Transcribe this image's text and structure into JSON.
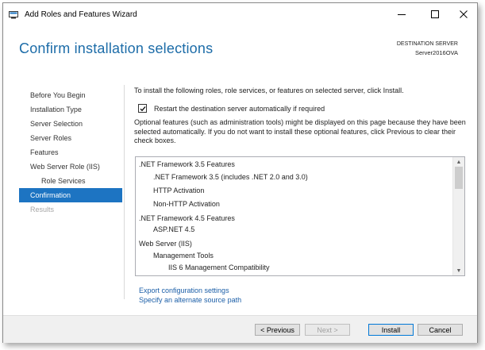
{
  "window": {
    "title": "Add Roles and Features Wizard",
    "controls": {
      "minimize": "—",
      "maximize": "☐",
      "close": "✕"
    }
  },
  "header": {
    "page_title": "Confirm installation selections",
    "destination_label": "DESTINATION SERVER",
    "destination_server": "Server2016OVA"
  },
  "nav": {
    "items": [
      {
        "label": "Before You Begin",
        "state": "normal"
      },
      {
        "label": "Installation Type",
        "state": "normal"
      },
      {
        "label": "Server Selection",
        "state": "normal"
      },
      {
        "label": "Server Roles",
        "state": "normal"
      },
      {
        "label": "Features",
        "state": "normal"
      },
      {
        "label": "Web Server Role (IIS)",
        "state": "normal"
      },
      {
        "label": "Role Services",
        "state": "normal"
      },
      {
        "label": "Confirmation",
        "state": "active"
      },
      {
        "label": "Results",
        "state": "disabled"
      }
    ]
  },
  "content": {
    "intro": "To install the following roles, role services, or features on selected server, click Install.",
    "restart_checked": true,
    "restart_label": "Restart the destination server automatically if required",
    "optional_text": "Optional features (such as administration tools) might be displayed on this page because they have been selected automatically. If you do not want to install these optional features, click Previous to clear their check boxes.",
    "features": [
      {
        "label": ".NET Framework 3.5 Features",
        "level": 0
      },
      {
        "label": ".NET Framework 3.5 (includes .NET 2.0 and 3.0)",
        "level": 1
      },
      {
        "label": "HTTP Activation",
        "level": 1
      },
      {
        "label": "Non-HTTP Activation",
        "level": 1
      },
      {
        "label": ".NET Framework 4.5 Features",
        "level": 0
      },
      {
        "label": "ASP.NET 4.5",
        "level": 1
      },
      {
        "label": "Web Server (IIS)",
        "level": 0
      },
      {
        "label": "Management Tools",
        "level": 1
      },
      {
        "label": "IIS 6 Management Compatibility",
        "level": 2
      }
    ],
    "export_link": "Export configuration settings",
    "alternate_source_link": "Specify an alternate source path"
  },
  "footer": {
    "previous": "< Previous",
    "next": "Next >",
    "install": "Install",
    "cancel": "Cancel"
  },
  "colors": {
    "accent": "#1d74c2",
    "title_blue": "#1c6ca8",
    "link_blue": "#1c5fa8"
  }
}
